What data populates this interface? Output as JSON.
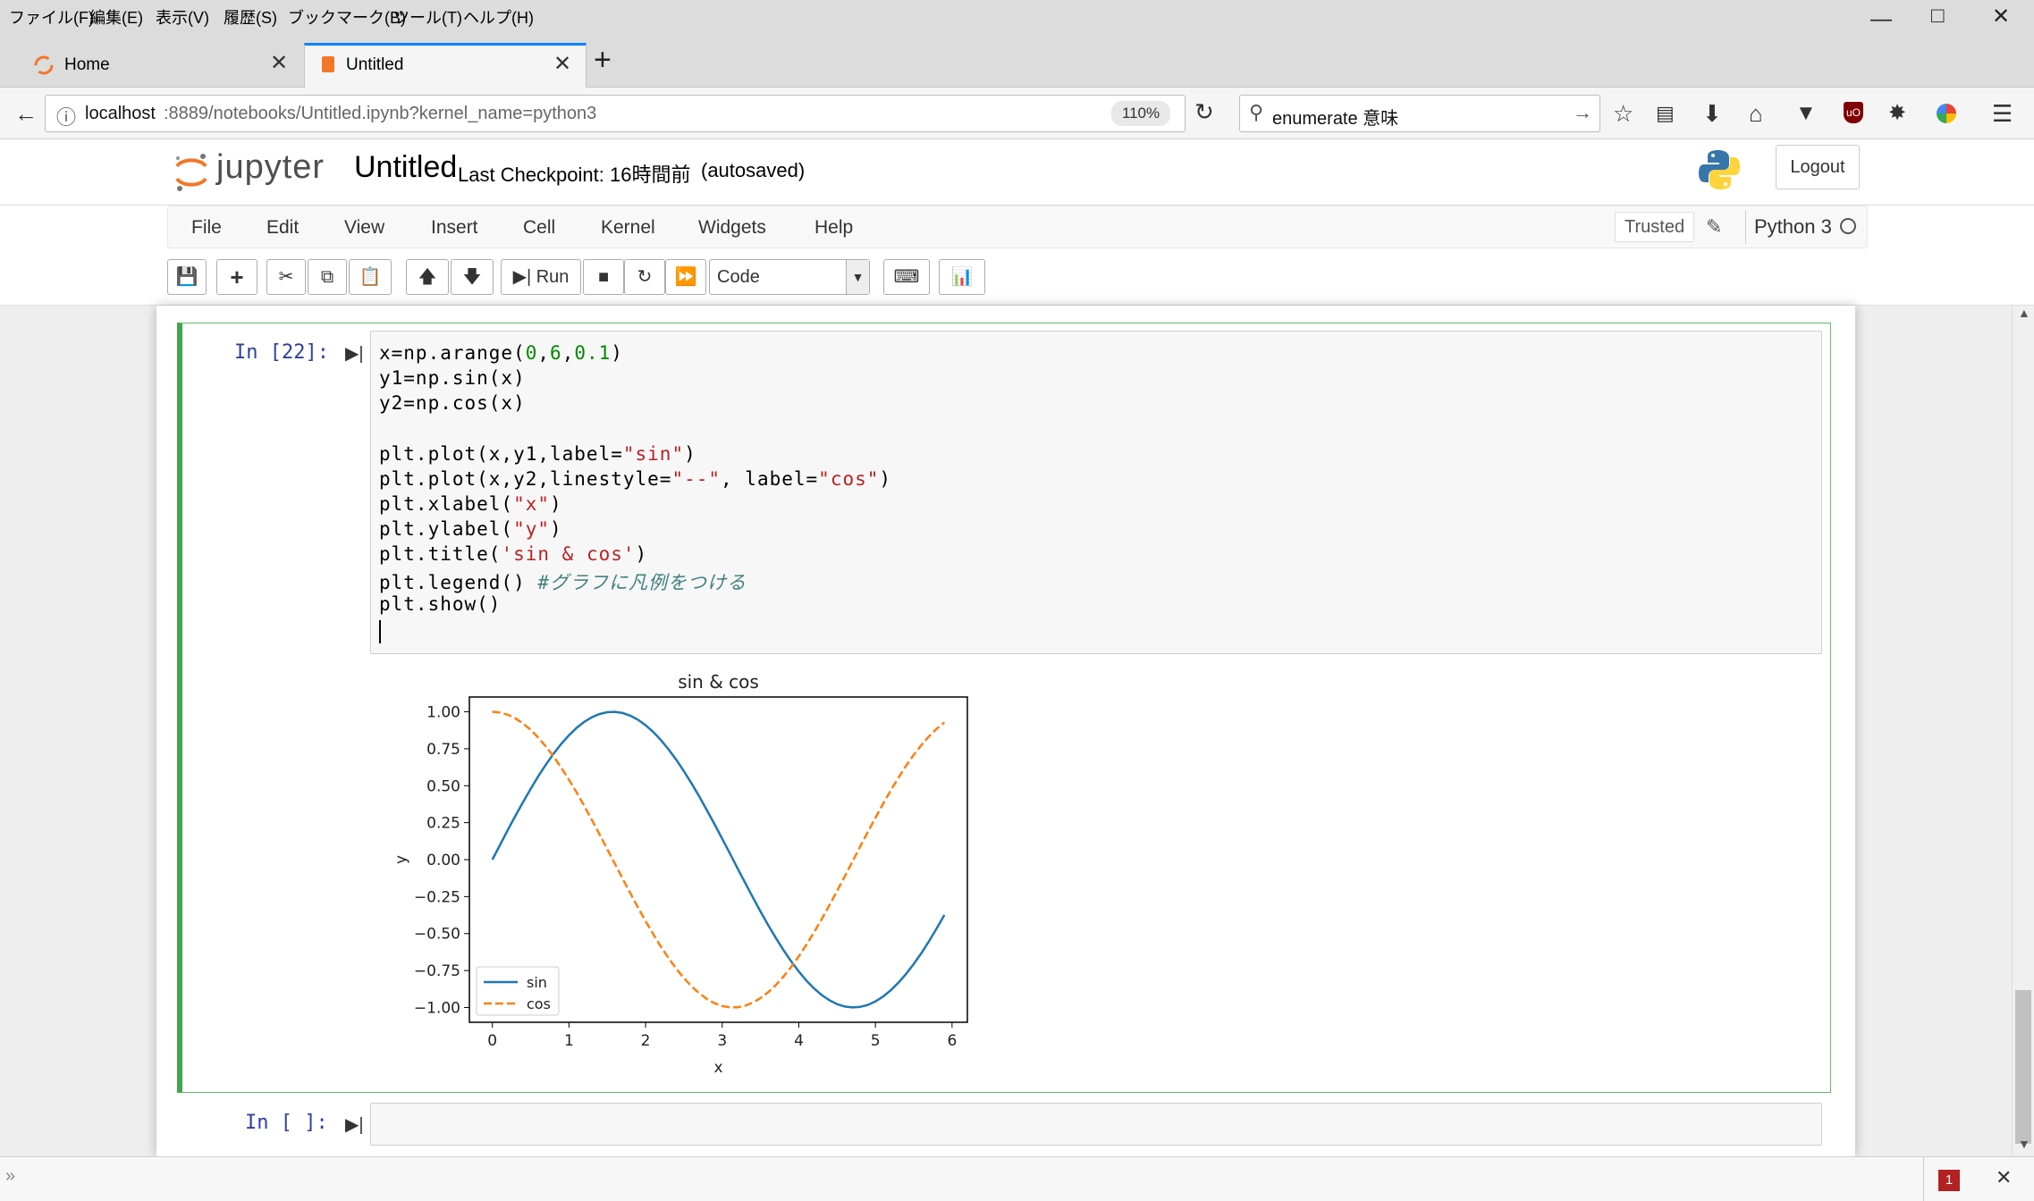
{
  "os_menu": [
    "ファイル(F)",
    "編集(E)",
    "表示(V)",
    "履歴(S)",
    "ブックマーク(B)",
    "ツール(T)",
    "ヘルプ(H)"
  ],
  "tabs": [
    {
      "label": "Home",
      "active": false
    },
    {
      "label": "Untitled",
      "active": true
    }
  ],
  "new_tab_label": "+",
  "address": {
    "host": "localhost",
    "rest": ":8889/notebooks/Untitled.ipynb?kernel_name=python3",
    "zoom": "110%"
  },
  "search": {
    "value": "enumerate 意味"
  },
  "jupyter": {
    "logo_text": "jupyter",
    "notebook_name": "Untitled",
    "checkpoint": "Last Checkpoint: 16時間前",
    "autosave": "(autosaved)",
    "logout": "Logout",
    "menu": [
      "File",
      "Edit",
      "View",
      "Insert",
      "Cell",
      "Kernel",
      "Widgets",
      "Help"
    ],
    "trusted": "Trusted",
    "kernel": "Python 3",
    "run_label": "Run",
    "cell_type": "Code"
  },
  "cells": [
    {
      "prompt": "In [22]:",
      "code": [
        "x=np.arange(0,6,0.1)",
        "y1=np.sin(x)",
        "y2=np.cos(x)",
        "",
        "plt.plot(x,y1,label=\"sin\")",
        "plt.plot(x,y2,linestyle=\"--\", label=\"cos\")",
        "plt.xlabel(\"x\")",
        "plt.ylabel(\"y\")",
        "plt.title('sin & cos')",
        "plt.legend() #グラフに凡例をつける",
        "plt.show()"
      ]
    },
    {
      "prompt": "In [ ]:",
      "code": []
    }
  ],
  "chart_data": {
    "type": "line",
    "title": "sin & cos",
    "xlabel": "x",
    "ylabel": "y",
    "xlim": [
      -0.3,
      6.2
    ],
    "ylim": [
      -1.1,
      1.1
    ],
    "xticks": [
      "0",
      "1",
      "2",
      "3",
      "4",
      "5",
      "6"
    ],
    "yticks": [
      "1.00",
      "0.75",
      "0.50",
      "0.25",
      "0.00",
      "−0.25",
      "−0.50",
      "−0.75",
      "−1.00"
    ],
    "x": [
      0.0,
      0.1,
      0.2,
      0.3,
      0.4,
      0.5,
      0.6,
      0.7,
      0.8,
      0.9,
      1.0,
      1.1,
      1.2,
      1.3,
      1.4,
      1.5,
      1.6,
      1.7,
      1.8,
      1.9,
      2.0,
      2.1,
      2.2,
      2.3,
      2.4,
      2.5,
      2.6,
      2.7,
      2.8,
      2.9,
      3.0,
      3.1,
      3.2,
      3.3,
      3.4,
      3.5,
      3.6,
      3.7,
      3.8,
      3.9,
      4.0,
      4.1,
      4.2,
      4.3,
      4.4,
      4.5,
      4.6,
      4.7,
      4.8,
      4.9,
      5.0,
      5.1,
      5.2,
      5.3,
      5.4,
      5.5,
      5.6,
      5.7,
      5.8,
      5.9
    ],
    "series": [
      {
        "name": "sin",
        "color": "#1f77b4",
        "dash": "solid",
        "values": [
          0.0,
          0.0998,
          0.1987,
          0.2955,
          0.3894,
          0.4794,
          0.5646,
          0.6442,
          0.7174,
          0.7833,
          0.8415,
          0.8912,
          0.932,
          0.9636,
          0.9854,
          0.9975,
          0.9996,
          0.9917,
          0.9738,
          0.9463,
          0.9093,
          0.8632,
          0.8085,
          0.7457,
          0.6755,
          0.5985,
          0.5155,
          0.4274,
          0.335,
          0.2392,
          0.1411,
          0.0416,
          -0.0584,
          -0.1577,
          -0.2555,
          -0.3508,
          -0.4425,
          -0.5298,
          -0.6119,
          -0.6878,
          -0.7568,
          -0.8183,
          -0.8716,
          -0.9162,
          -0.9516,
          -0.9775,
          -0.9937,
          -0.9999,
          -0.9962,
          -0.9825,
          -0.9589,
          -0.9258,
          -0.8835,
          -0.8323,
          -0.7728,
          -0.7055,
          -0.6313,
          -0.5507,
          -0.4646,
          -0.3739
        ]
      },
      {
        "name": "cos",
        "color": "#ff7f0e",
        "dash": "dashed",
        "values": [
          1.0,
          0.995,
          0.9801,
          0.9553,
          0.9211,
          0.8776,
          0.8253,
          0.7648,
          0.6967,
          0.6216,
          0.5403,
          0.4536,
          0.3624,
          0.2675,
          0.17,
          0.0707,
          -0.0292,
          -0.1288,
          -0.2272,
          -0.3233,
          -0.4161,
          -0.5048,
          -0.5885,
          -0.6663,
          -0.7374,
          -0.8011,
          -0.8569,
          -0.9041,
          -0.9422,
          -0.971,
          -0.99,
          -0.9991,
          -0.9983,
          -0.9875,
          -0.9668,
          -0.9365,
          -0.8968,
          -0.8481,
          -0.791,
          -0.7259,
          -0.6536,
          -0.5748,
          -0.4903,
          -0.4008,
          -0.3073,
          -0.2108,
          -0.1122,
          -0.0124,
          0.0875,
          0.1865,
          0.2837,
          0.378,
          0.4685,
          0.5544,
          0.6347,
          0.7087,
          0.7756,
          0.8347,
          0.8855,
          0.9275
        ]
      }
    ],
    "legend": "lower-left",
    "grid": false
  },
  "status": {
    "badge": "1"
  }
}
